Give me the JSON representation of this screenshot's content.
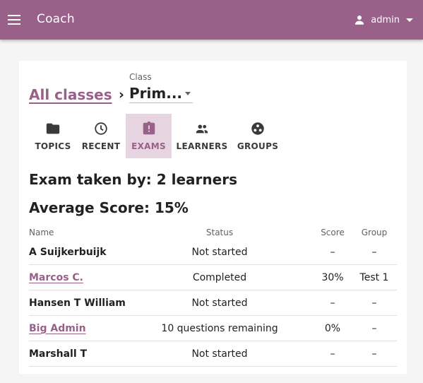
{
  "appbar": {
    "title": "Coach",
    "user": "admin",
    "menu_icon": "menu-icon",
    "user_icon": "person-icon",
    "color": "#996189"
  },
  "breadcrumb": {
    "all_classes": "All classes",
    "separator": "›",
    "class_label": "Class",
    "class_value": "Prim..."
  },
  "tabs": [
    {
      "label": "TOPICS",
      "icon": "folder-icon",
      "active": false
    },
    {
      "label": "RECENT",
      "icon": "clock-icon",
      "active": false
    },
    {
      "label": "EXAMS",
      "icon": "exam-icon",
      "active": true
    },
    {
      "label": "LEARNERS",
      "icon": "people-icon",
      "active": false
    },
    {
      "label": "GROUPS",
      "icon": "groups-icon",
      "active": false
    }
  ],
  "summary": {
    "taken_by": "Exam taken by: 2 learners",
    "average": "Average Score: 15%"
  },
  "table": {
    "headers": {
      "name": "Name",
      "status": "Status",
      "score": "Score",
      "group": "Group"
    },
    "rows": [
      {
        "name": "A Suijkerbuijk",
        "status": "Not started",
        "score": "–",
        "group": "–",
        "link": false
      },
      {
        "name": "Marcos C.",
        "status": "Completed",
        "score": "30%",
        "group": "Test 1",
        "link": true
      },
      {
        "name": "Hansen T William",
        "status": "Not started",
        "score": "–",
        "group": "–",
        "link": false
      },
      {
        "name": "Big Admin",
        "status": "10 questions remaining",
        "score": "0%",
        "group": "–",
        "link": true
      },
      {
        "name": "Marshall T",
        "status": "Not started",
        "score": "–",
        "group": "–",
        "link": false
      }
    ]
  }
}
